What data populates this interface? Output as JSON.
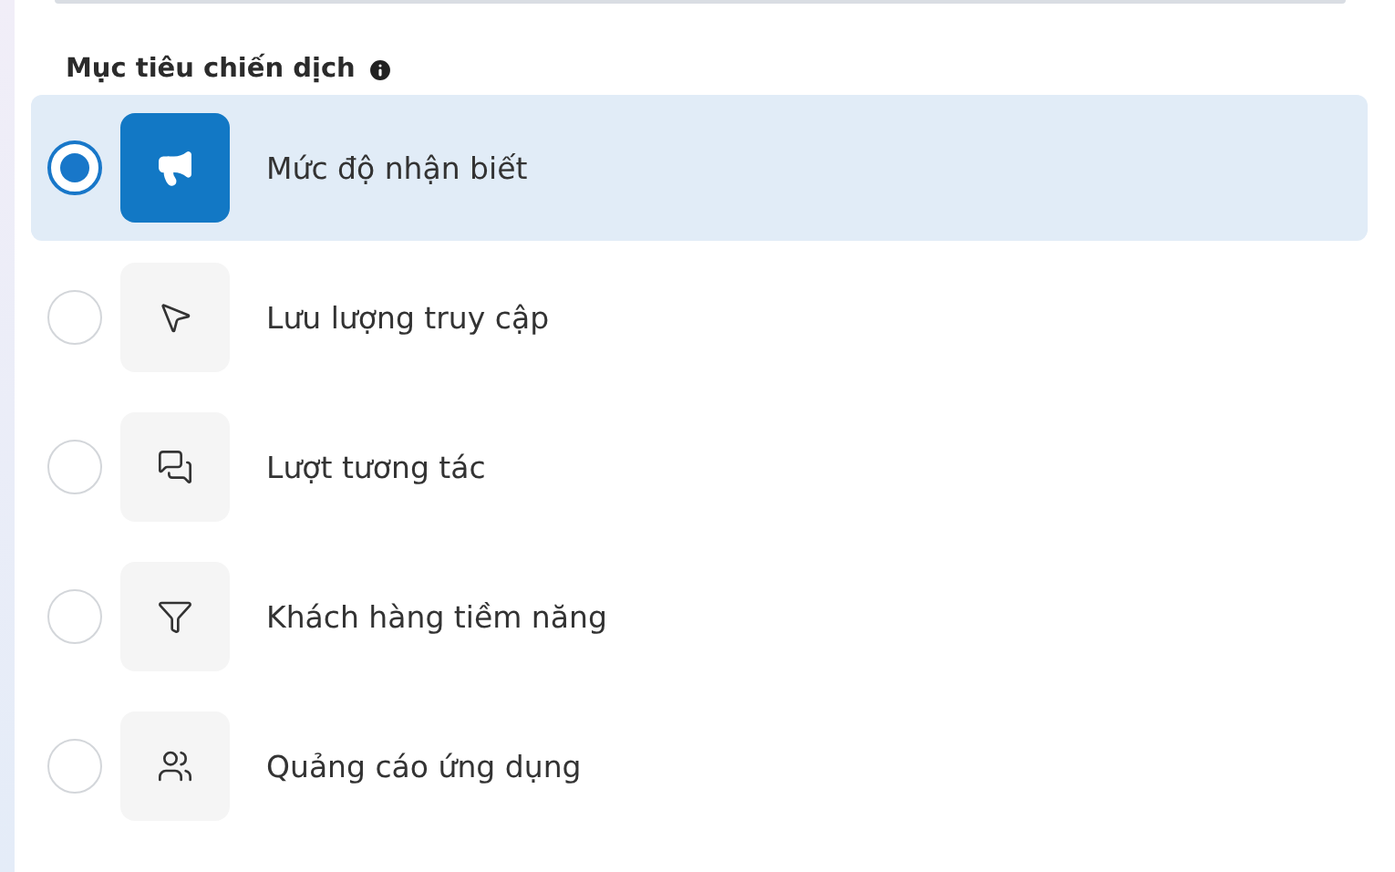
{
  "section": {
    "title": "Mục tiêu chiến dịch"
  },
  "objectives": [
    {
      "label": "Mức độ nhận biết",
      "kind": "awareness",
      "selected": true
    },
    {
      "label": "Lưu lượng truy cập",
      "kind": "traffic",
      "selected": false
    },
    {
      "label": "Lượt tương tác",
      "kind": "engagement",
      "selected": false
    },
    {
      "label": "Khách hàng tiềm năng",
      "kind": "leads",
      "selected": false
    },
    {
      "label": "Quảng cáo ứng dụng",
      "kind": "app",
      "selected": false
    }
  ]
}
